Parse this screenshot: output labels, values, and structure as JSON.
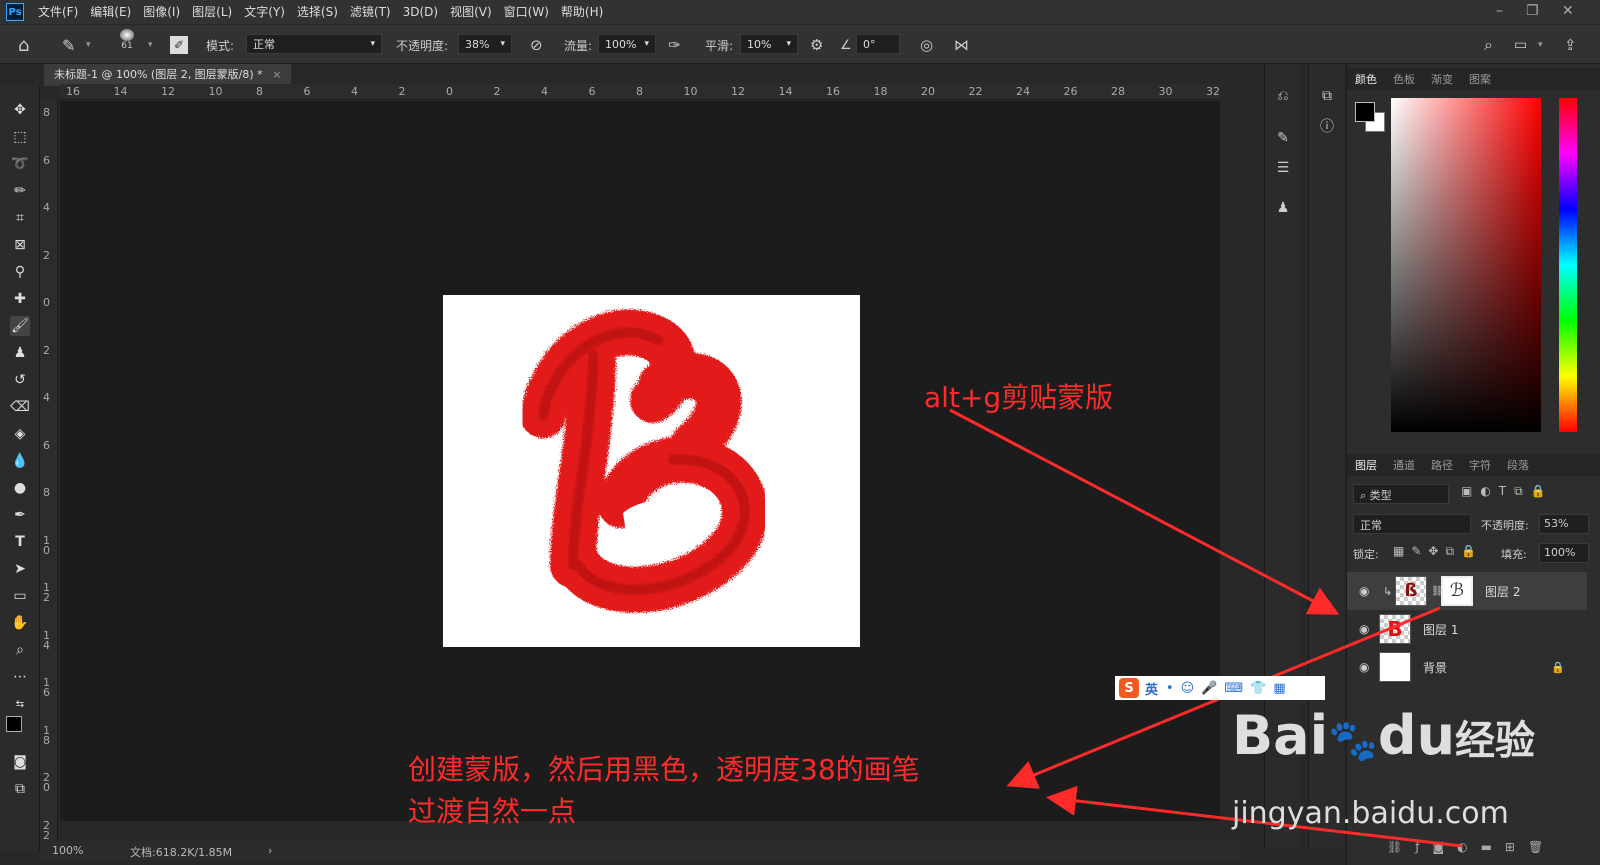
{
  "app": {
    "logo": "Ps"
  },
  "menu": [
    "文件(F)",
    "编辑(E)",
    "图像(I)",
    "图层(L)",
    "文字(Y)",
    "选择(S)",
    "滤镜(T)",
    "3D(D)",
    "视图(V)",
    "窗口(W)",
    "帮助(H)"
  ],
  "options": {
    "brush_size": "61",
    "mode_label": "模式:",
    "mode_value": "正常",
    "opacity_label": "不透明度:",
    "opacity_value": "38%",
    "flow_label": "流量:",
    "flow_value": "100%",
    "smooth_label": "平滑:",
    "smooth_value": "10%",
    "angle_value": "0°"
  },
  "document": {
    "tab_title": "未标题-1 @ 100% (图层 2, 图层蒙版/8) *",
    "close_glyph": "×"
  },
  "ruler_h": [
    "16",
    "14",
    "12",
    "10",
    "8",
    "6",
    "4",
    "2",
    "0",
    "2",
    "4",
    "6",
    "8",
    "10",
    "12",
    "14",
    "16",
    "18",
    "20",
    "22",
    "24",
    "26",
    "28",
    "30",
    "32"
  ],
  "ruler_v": [
    "8",
    "6",
    "4",
    "2",
    "0",
    "2",
    "4",
    "6",
    "8",
    "1 0",
    "1 2",
    "1 4",
    "1 6",
    "1 8",
    "2 0",
    "2 2"
  ],
  "status": {
    "zoom": "100%",
    "doc_info": "文档:618.2K/1.85M",
    "arrow": "›"
  },
  "color_panel": {
    "tabs": [
      "颜色",
      "色板",
      "渐变",
      "图案"
    ],
    "foreground": "#000000",
    "background": "#ffffff"
  },
  "layers_panel": {
    "tabs": [
      "图层",
      "通道",
      "路径",
      "字符",
      "段落"
    ],
    "filter_label": "类型",
    "blend_mode": "正常",
    "opacity_label": "不透明度:",
    "opacity_value": "53%",
    "lock_label": "锁定:",
    "fill_label": "填充:",
    "fill_value": "100%",
    "layers": [
      {
        "name": "图层 2",
        "clipped": true,
        "has_mask": true,
        "selected": true
      },
      {
        "name": "图层 1",
        "clipped": false,
        "has_mask": false,
        "selected": false
      },
      {
        "name": "背景",
        "clipped": false,
        "has_mask": false,
        "selected": false,
        "locked": true
      }
    ]
  },
  "annotations": {
    "top": "alt+g剪贴蒙版",
    "bottom_line1": "创建蒙版，然后用黑色，透明度38的画笔",
    "bottom_line2": "过渡自然一点",
    "color": "#ff2b2b"
  },
  "ime": {
    "label": "英"
  },
  "watermark": {
    "brand": "Bai",
    "brand_du": "du",
    "cn": "经验",
    "url": "jingyan.baidu.com"
  },
  "artwork": {
    "letter": "B",
    "color": "#e01010"
  }
}
